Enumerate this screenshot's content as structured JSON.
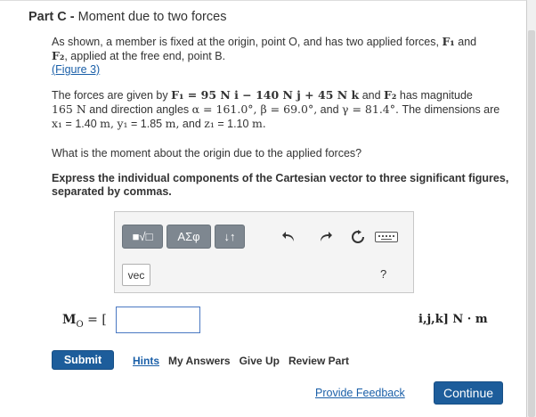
{
  "part": {
    "label": "Part C",
    "separator": "-",
    "title": "Moment due to two forces"
  },
  "problem": {
    "intro_a": "As shown, a member is fixed at the origin, point O, and has two applied forces,",
    "f1": "F₁",
    "and": "and",
    "f2": "F₂",
    "intro_b": ", applied at the free end, point B.",
    "figure_link": "(Figure 3)",
    "forces_a": "The forces are given by",
    "f1_expr": "F₁ = 95 N i − 140 N j + 45 N k",
    "forces_b": "and",
    "f2_label": "F₂",
    "forces_c": "has magnitude",
    "f2_mag": "165 N",
    "forces_d": "and direction angles",
    "angles": "α = 161.0°, β = 69.0°,",
    "and2": "and",
    "gamma": "γ = 81.4°.",
    "dims_a": "The dimensions are",
    "x1": "x₁",
    "x1_val": "= 1.40",
    "unit_m1": "m,",
    "y1": "y₁",
    "y1_val": "= 1.85",
    "unit_m2": "m,",
    "and3": "and",
    "z1": "z₁",
    "z1_val": "= 1.10",
    "unit_m3": "m.",
    "question": "What is the moment about the origin due to the applied forces?",
    "instruction": "Express the individual components of the Cartesian vector to three significant figures, separated by commas."
  },
  "toolbar": {
    "templates_label": "■√□",
    "greek_label": "AΣφ",
    "arrows_label": "↓↑",
    "vec_label": "vec",
    "help_label": "?"
  },
  "answer": {
    "label": "M",
    "label_sub": "O",
    "eq": "= [",
    "value": "",
    "units": "i,j,k] N · m"
  },
  "actions": {
    "submit": "Submit",
    "hints": "Hints",
    "my_answers": "My Answers",
    "give_up": "Give Up",
    "review_part": "Review Part"
  },
  "footer": {
    "feedback": "Provide Feedback",
    "continue": "Continue"
  },
  "colors": {
    "primary_button": "#1d5d9b",
    "link": "#1a5fa8",
    "toolbar_group": "#7e8790",
    "input_border": "#4a78c2"
  }
}
